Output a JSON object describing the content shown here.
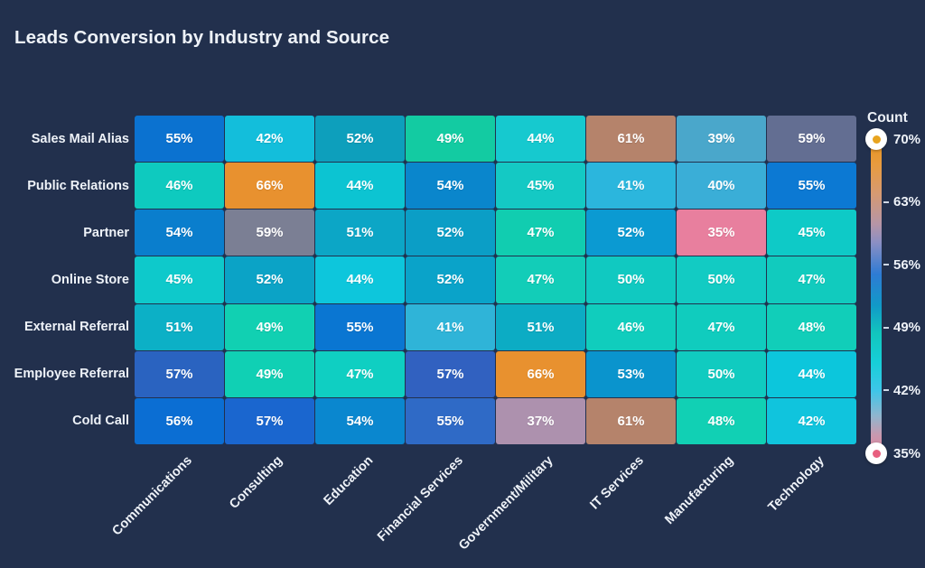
{
  "chart_data": {
    "type": "heatmap",
    "title": "Leads Conversion by Industry and Source",
    "xlabel": "",
    "ylabel": "",
    "x_categories": [
      "Communications",
      "Consulting",
      "Education",
      "Financial Services",
      "Government/Military",
      "IT Services",
      "Manufacturing",
      "Technology"
    ],
    "y_categories": [
      "Sales Mail Alias",
      "Public Relations",
      "Partner",
      "Online Store",
      "External Referral",
      "Employee Referral",
      "Cold Call"
    ],
    "value_suffix": "%",
    "rows": [
      {
        "label": "Sales Mail Alias",
        "cells": [
          {
            "value": "55%",
            "color": "#0b72d0"
          },
          {
            "value": "42%",
            "color": "#13bedb"
          },
          {
            "value": "52%",
            "color": "#0d9fbc"
          },
          {
            "value": "49%",
            "color": "#13cba2"
          },
          {
            "value": "44%",
            "color": "#16c9cf"
          },
          {
            "value": "61%",
            "color": "#b5836b"
          },
          {
            "value": "39%",
            "color": "#4aa7cb"
          },
          {
            "value": "59%",
            "color": "#636e92"
          }
        ]
      },
      {
        "label": "Public Relations",
        "cells": [
          {
            "value": "46%",
            "color": "#0ecabf"
          },
          {
            "value": "66%",
            "color": "#e8912f"
          },
          {
            "value": "44%",
            "color": "#0cc4d2"
          },
          {
            "value": "54%",
            "color": "#0a86cc"
          },
          {
            "value": "45%",
            "color": "#14c9c4"
          },
          {
            "value": "41%",
            "color": "#2bb6dd"
          },
          {
            "value": "40%",
            "color": "#3aaed7"
          },
          {
            "value": "55%",
            "color": "#0c79d3"
          }
        ]
      },
      {
        "label": "Partner",
        "cells": [
          {
            "value": "54%",
            "color": "#0a7ecd"
          },
          {
            "value": "59%",
            "color": "#7b7f94"
          },
          {
            "value": "51%",
            "color": "#0ca6c6"
          },
          {
            "value": "52%",
            "color": "#0b9ec6"
          },
          {
            "value": "47%",
            "color": "#11cdb0"
          },
          {
            "value": "52%",
            "color": "#0b9ad2"
          },
          {
            "value": "35%",
            "color": "#e87f9e"
          },
          {
            "value": "45%",
            "color": "#0ecac7"
          }
        ]
      },
      {
        "label": "Online Store",
        "cells": [
          {
            "value": "45%",
            "color": "#0ec9cb"
          },
          {
            "value": "52%",
            "color": "#0ba3c6"
          },
          {
            "value": "44%",
            "color": "#0dc6dc"
          },
          {
            "value": "52%",
            "color": "#0aa3c9"
          },
          {
            "value": "47%",
            "color": "#12cdb8"
          },
          {
            "value": "50%",
            "color": "#10c9c1"
          },
          {
            "value": "50%",
            "color": "#12cbc3"
          },
          {
            "value": "47%",
            "color": "#11cbbe"
          }
        ]
      },
      {
        "label": "External Referral",
        "cells": [
          {
            "value": "51%",
            "color": "#0cb0c6"
          },
          {
            "value": "49%",
            "color": "#11d0b2"
          },
          {
            "value": "55%",
            "color": "#0a76d2"
          },
          {
            "value": "41%",
            "color": "#2fb4d8"
          },
          {
            "value": "51%",
            "color": "#0cacc4"
          },
          {
            "value": "46%",
            "color": "#10cdbd"
          },
          {
            "value": "47%",
            "color": "#10ccbe"
          },
          {
            "value": "48%",
            "color": "#11ceb9"
          }
        ]
      },
      {
        "label": "Employee Referral",
        "cells": [
          {
            "value": "57%",
            "color": "#2a63c0"
          },
          {
            "value": "49%",
            "color": "#10d0b4"
          },
          {
            "value": "47%",
            "color": "#0fcfc2"
          },
          {
            "value": "57%",
            "color": "#3161c0"
          },
          {
            "value": "66%",
            "color": "#e8912f"
          },
          {
            "value": "53%",
            "color": "#0a94cd"
          },
          {
            "value": "50%",
            "color": "#10cbc0"
          },
          {
            "value": "44%",
            "color": "#0cc6dc"
          }
        ]
      },
      {
        "label": "Cold Call",
        "cells": [
          {
            "value": "56%",
            "color": "#0b6ed3"
          },
          {
            "value": "57%",
            "color": "#1a66cf"
          },
          {
            "value": "54%",
            "color": "#0a87cf"
          },
          {
            "value": "55%",
            "color": "#2f6ac6"
          },
          {
            "value": "37%",
            "color": "#ad91ae"
          },
          {
            "value": "61%",
            "color": "#b5836b"
          },
          {
            "value": "48%",
            "color": "#11d0b4"
          },
          {
            "value": "42%",
            "color": "#10c4dd"
          }
        ]
      }
    ],
    "legend": {
      "title": "Count",
      "max_label": "70%",
      "min_label": "35%",
      "ticks": [
        "70%",
        "63%",
        "56%",
        "49%",
        "42%",
        "35%"
      ],
      "gradient_stops": [
        "#e8941f",
        "#d79a70",
        "#8a8fc4",
        "#2e7bd4",
        "#1199c8",
        "#12c6bd",
        "#3ec6e8",
        "#8fb6cf",
        "#e3859e"
      ]
    },
    "background_color": "#22304d",
    "text_color": "#eef2f8"
  }
}
